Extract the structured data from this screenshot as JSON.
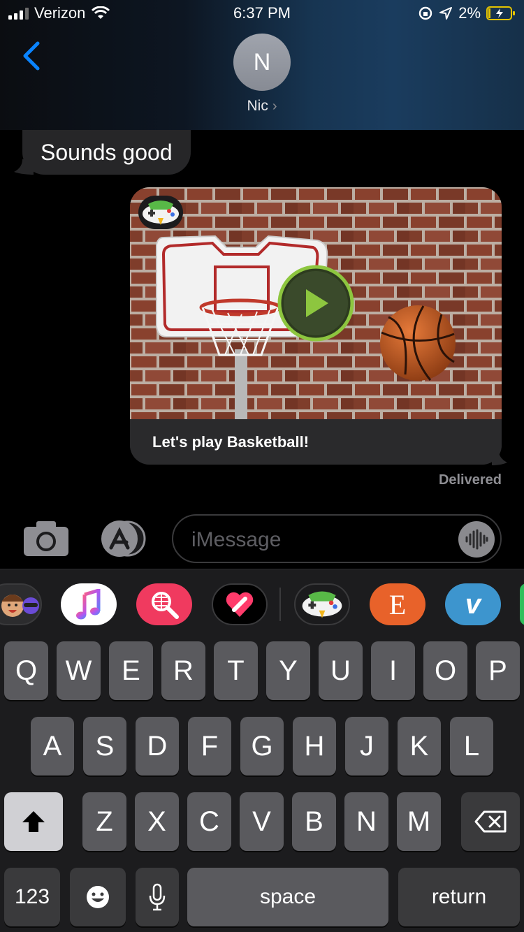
{
  "status_bar": {
    "carrier": "Verizon",
    "time": "6:37 PM",
    "battery": "2%"
  },
  "header": {
    "avatar_initial": "N",
    "contact_name": "Nic",
    "chevron": "›"
  },
  "messages": {
    "incoming_text": "Sounds good",
    "card_caption": "Let's play Basketball!",
    "status": "Delivered"
  },
  "compose": {
    "placeholder": "iMessage"
  },
  "app_drawer": {
    "apps": [
      "memoji-stickers",
      "apple-music",
      "image-search",
      "digital-touch",
      "game-pigeon",
      "etsy",
      "venmo"
    ],
    "etsy_letter": "E",
    "venmo_letter": "V"
  },
  "keyboard": {
    "row1": [
      "Q",
      "W",
      "E",
      "R",
      "T",
      "Y",
      "U",
      "I",
      "O",
      "P"
    ],
    "row2": [
      "A",
      "S",
      "D",
      "F",
      "G",
      "H",
      "J",
      "K",
      "L"
    ],
    "row3": [
      "Z",
      "X",
      "C",
      "V",
      "B",
      "N",
      "M"
    ],
    "numbers_key": "123",
    "space_key": "space",
    "return_key": "return"
  },
  "colors": {
    "accent_blue": "#0a84ff",
    "bubble_incoming": "#262628",
    "key_gray": "#5a5a5e",
    "play_green": "#8dc63f"
  }
}
